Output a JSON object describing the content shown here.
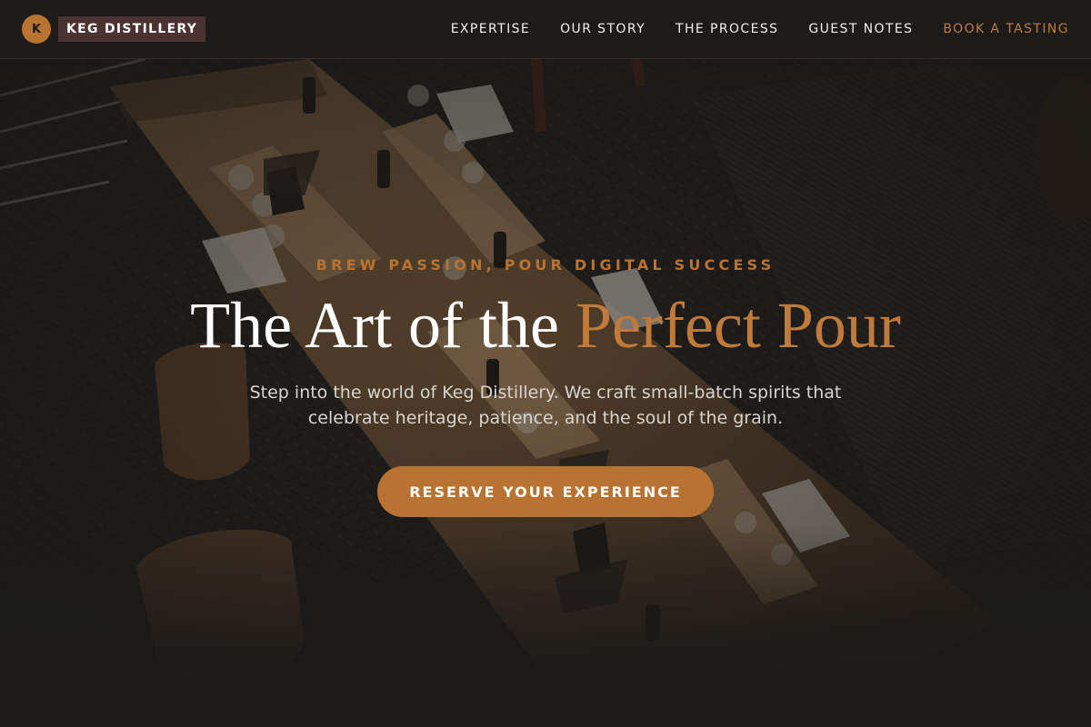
{
  "brand": {
    "initial": "K",
    "name": "KEG DISTILLERY",
    "accent_color": "#b87332",
    "name_bg_color": "#4a3330"
  },
  "nav": {
    "items": [
      {
        "label": "EXPERTISE"
      },
      {
        "label": "OUR STORY"
      },
      {
        "label": "THE PROCESS"
      },
      {
        "label": "GUEST NOTES"
      },
      {
        "label": "BOOK A TASTING"
      }
    ]
  },
  "hero": {
    "tagline": "BREW PASSION, POUR DIGITAL SUCCESS",
    "headline_main": "The Art of the",
    "headline_accent": "Perfect Pour",
    "subtext": "Step into the world of Keg Distillery. We craft small-batch spirits that celebrate heritage, patience, and the soul of the grain.",
    "cta_label": "RESERVE YOUR EXPERIENCE"
  }
}
